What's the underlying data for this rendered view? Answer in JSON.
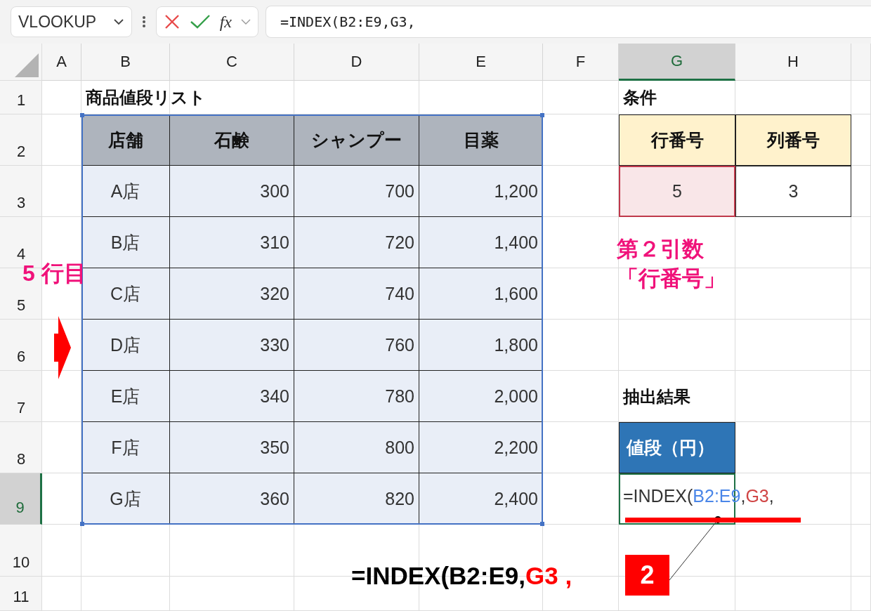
{
  "formula_bar": {
    "name_box": "VLOOKUP",
    "function_button": "fx",
    "formula": "=INDEX(B2:E9,G3,"
  },
  "columns": [
    {
      "label": "A",
      "selected": false
    },
    {
      "label": "B",
      "selected": false
    },
    {
      "label": "C",
      "selected": false
    },
    {
      "label": "D",
      "selected": false
    },
    {
      "label": "E",
      "selected": false
    },
    {
      "label": "F",
      "selected": false
    },
    {
      "label": "G",
      "selected": true
    },
    {
      "label": "H",
      "selected": false
    }
  ],
  "rows": [
    {
      "label": "1",
      "selected": false
    },
    {
      "label": "2",
      "selected": false
    },
    {
      "label": "3",
      "selected": false
    },
    {
      "label": "4",
      "selected": false
    },
    {
      "label": "5",
      "selected": false
    },
    {
      "label": "6",
      "selected": false
    },
    {
      "label": "7",
      "selected": false
    },
    {
      "label": "8",
      "selected": false
    },
    {
      "label": "9",
      "selected": true
    },
    {
      "label": "10",
      "selected": false
    },
    {
      "label": "11",
      "selected": false
    }
  ],
  "price_table": {
    "title": "商品値段リスト",
    "headers": [
      "店舗",
      "石鹸",
      "シャンプー",
      "目薬"
    ],
    "rows": [
      [
        "A店",
        "300",
        "700",
        "1,200"
      ],
      [
        "B店",
        "310",
        "720",
        "1,400"
      ],
      [
        "C店",
        "320",
        "740",
        "1,600"
      ],
      [
        "D店",
        "330",
        "760",
        "1,800"
      ],
      [
        "E店",
        "340",
        "780",
        "2,000"
      ],
      [
        "F店",
        "350",
        "800",
        "2,200"
      ],
      [
        "G店",
        "360",
        "820",
        "2,400"
      ]
    ]
  },
  "condition": {
    "title": "条件",
    "headers": [
      "行番号",
      "列番号"
    ],
    "values": [
      {
        "text": "5",
        "highlighted": true
      },
      {
        "text": "3",
        "highlighted": false
      }
    ]
  },
  "result": {
    "title": "抽出結果",
    "header": "値段（円）",
    "formula": [
      {
        "text": "=INDEX(",
        "kind": "plain"
      },
      {
        "text": "B2:E9",
        "kind": "ref_blue"
      },
      {
        "text": ",",
        "kind": "plain"
      },
      {
        "text": "G3",
        "kind": "ref_red"
      },
      {
        "text": ",",
        "kind": "plain"
      }
    ]
  },
  "annotations": {
    "row_label": "5 行目",
    "argument_note": [
      "第２引数",
      "「行番号」"
    ],
    "badge": "2",
    "formula_callout": [
      {
        "text": "=INDEX(B2:E9,",
        "kind": "plain"
      },
      {
        "text": "G3 ,",
        "kind": "accent"
      }
    ]
  }
}
